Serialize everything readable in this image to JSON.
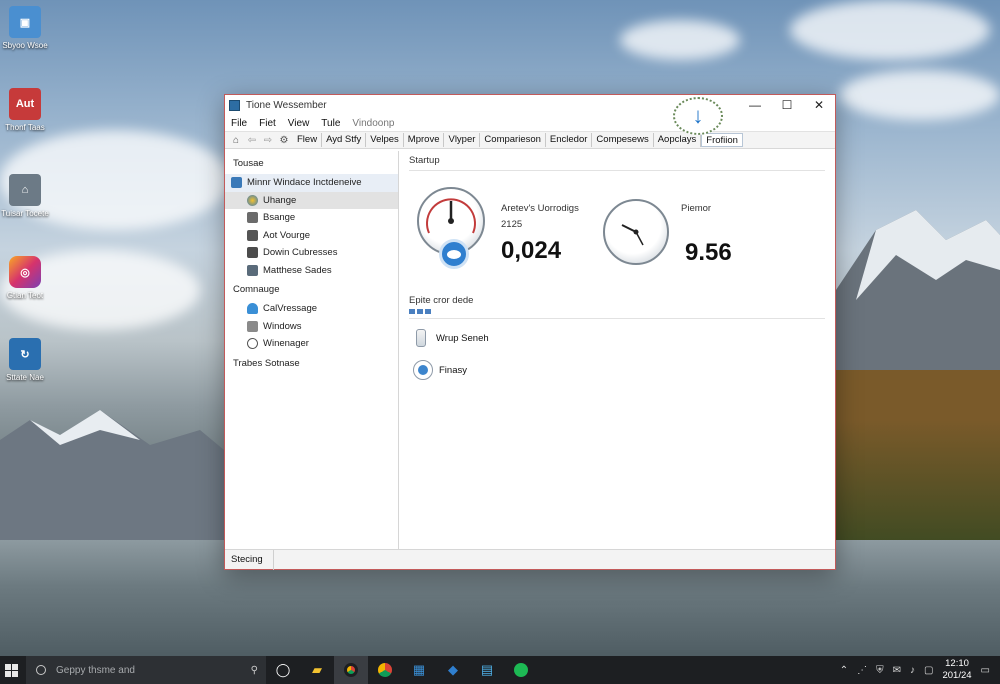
{
  "desktop": {
    "icons": [
      {
        "label": "Sbyoo Wsoe",
        "icon": "computer-icon",
        "color": "#4a8fd0"
      },
      {
        "label": "Thonf Taas",
        "icon": "pdf-icon",
        "glyph": "Aut",
        "color": "#c63a3a"
      },
      {
        "label": "Tuisar Tocete",
        "icon": "home-icon",
        "color": "#6c7a86"
      },
      {
        "label": "Gtian Teot",
        "icon": "instagram-icon",
        "color": "#d6336c"
      },
      {
        "label": "Sttate Nae",
        "icon": "share-icon",
        "color": "#2a6fb0"
      }
    ]
  },
  "window": {
    "title": "Tione Wessember",
    "menu": [
      "File",
      "Fiet",
      "View",
      "Tule",
      "Vindoonp"
    ],
    "toolbar": {
      "items": [
        "Flew",
        "Ayd Stfy",
        "Velpes",
        "Mprove",
        "Vlyper",
        "Comparieson",
        "Encledor",
        "Compesews",
        "Aopclays",
        "Frofiion"
      ],
      "active_index": 9
    },
    "sidebar": {
      "section1": "Tousae",
      "top_item": "Minnr Windace Inctdeneive",
      "items1": [
        "Uhange",
        "Bsange",
        "Aot Vourge",
        "Dowin Cubresses",
        "Matthese Sades"
      ],
      "selected_index": 0,
      "section2": "Comnauge",
      "items2": [
        "CalVressage",
        "Windows",
        "Winenager"
      ],
      "section3": "Trabes Sotnase"
    },
    "main": {
      "startup_heading": "Startup",
      "gauge1": {
        "label": "Aretev's Uorrodigs",
        "sublabel": "2125",
        "value": "0,024"
      },
      "gauge2": {
        "label": "Piemor",
        "value": "9.56"
      },
      "section2_heading": "Epite cror dede",
      "rows": [
        {
          "label": "Wrup Seneh",
          "icon": "cylinder-icon"
        },
        {
          "label": "Finasy",
          "icon": "globe-icon"
        }
      ]
    },
    "status": "Stecing",
    "download_icon": "download-arrow-icon"
  },
  "taskbar": {
    "search_placeholder": "Geppy thsme and",
    "apps": [
      "task-view-icon",
      "file-explorer-icon",
      "chrome-icon",
      "chrome-icon",
      "store-icon",
      "app-blue-icon",
      "app-window-icon",
      "spotify-icon"
    ],
    "clock_time": "12:10",
    "clock_date": "201/24"
  },
  "colors": {
    "accent": "#2d6da3",
    "window_border": "#c25a5a",
    "taskbar": "#1d1f22"
  }
}
